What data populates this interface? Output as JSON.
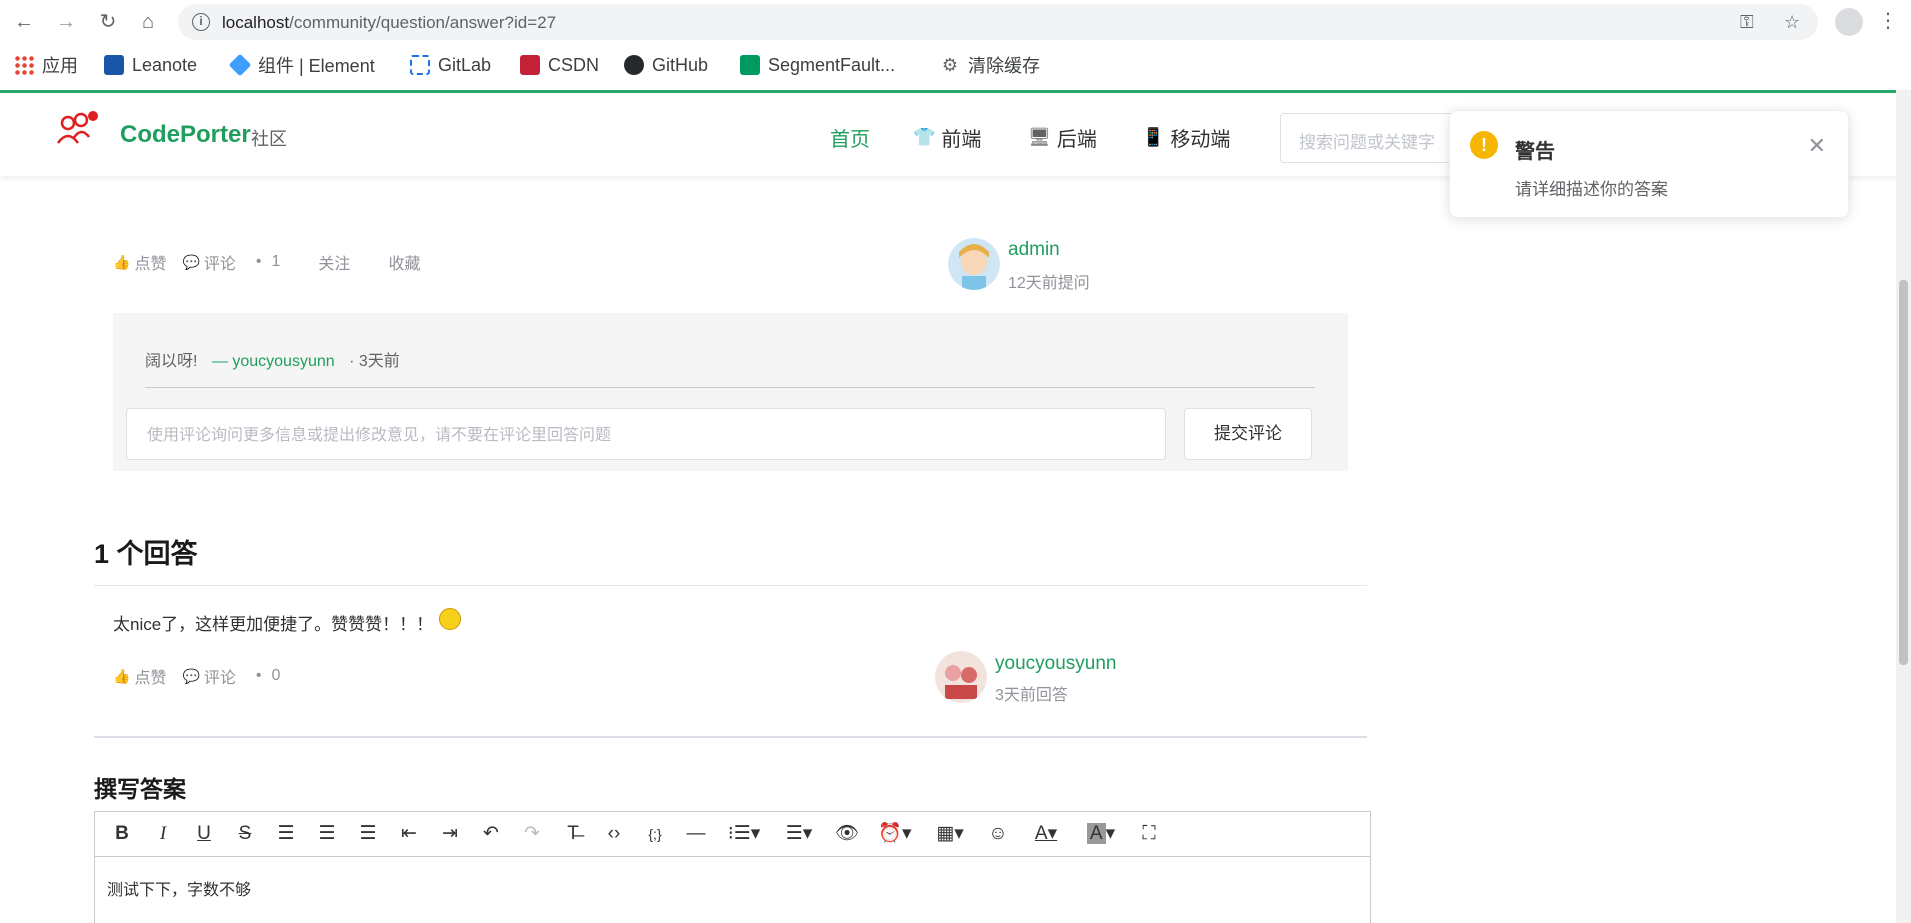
{
  "browser": {
    "url_host": "localhost",
    "url_path": "/community/question/answer?id=27"
  },
  "bookmarks": [
    {
      "label": "应用",
      "color": "#4285f4"
    },
    {
      "label": "Leanote",
      "color": "#1a56a8"
    },
    {
      "label": "组件 | Element",
      "color": "#409eff"
    },
    {
      "label": "GitLab",
      "color": "#e24329"
    },
    {
      "label": "CSDN",
      "color": "#c32136"
    },
    {
      "label": "GitHub",
      "color": "#24292e"
    },
    {
      "label": "SegmentFault...",
      "color": "#009a61"
    },
    {
      "label": "清除缓存",
      "color": "#5f6368"
    }
  ],
  "header": {
    "logo_text": "CodePorter",
    "logo_sub": "社区",
    "nav": [
      {
        "label": "首页",
        "active": true
      },
      {
        "label": "前端"
      },
      {
        "label": "后端"
      },
      {
        "label": "移动端"
      }
    ],
    "search_placeholder": "搜索问题或关键字"
  },
  "notification": {
    "title": "警告",
    "message": "请详细描述你的答案"
  },
  "question": {
    "like_label": "点赞",
    "comment_label": "评论",
    "comment_count": "1",
    "follow_label": "关注",
    "collect_label": "收藏",
    "author": "admin",
    "time": "12天前提问"
  },
  "comments": {
    "items": [
      {
        "text": "阔以呀!",
        "author": "— youcyousyunn",
        "time": "· 3天前"
      }
    ],
    "input_placeholder": "使用评论询问更多信息或提出修改意见，请不要在评论里回答问题",
    "submit_label": "提交评论"
  },
  "answers": {
    "title": "1 个回答",
    "items": [
      {
        "text": "太nice了，这样更加便捷了。赞赞赞！！！",
        "like_label": "点赞",
        "comment_label": "评论",
        "comment_count": "0",
        "author": "youcyousyunn",
        "time": "3天前回答"
      }
    ]
  },
  "write": {
    "title": "撰写答案",
    "content": "测试下下，字数不够"
  },
  "colors": {
    "brand": "#1f9e5e",
    "warning": "#f5b500"
  }
}
